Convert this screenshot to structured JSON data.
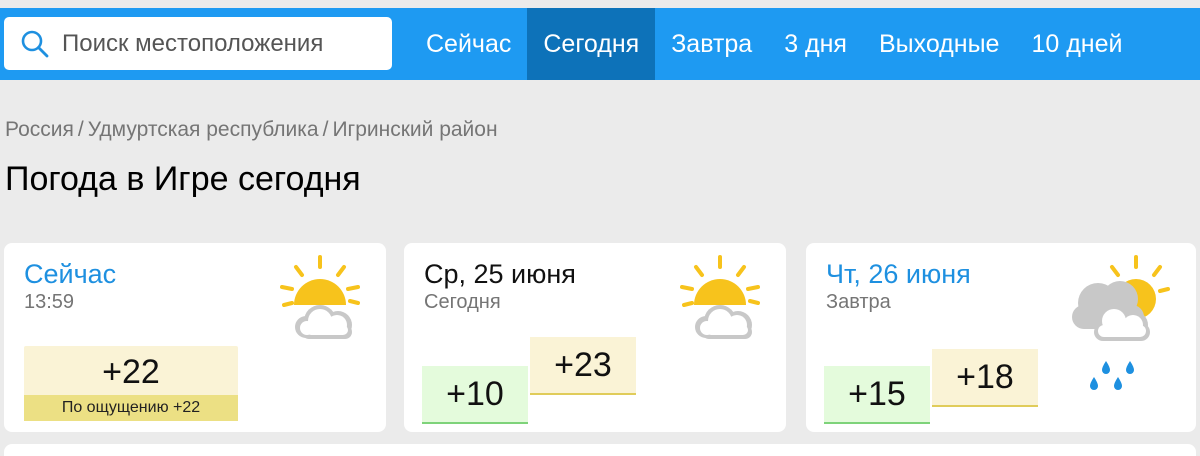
{
  "search": {
    "placeholder": "Поиск местоположения"
  },
  "nav": {
    "tabs": [
      {
        "label": "Сейчас",
        "active": false
      },
      {
        "label": "Сегодня",
        "active": true
      },
      {
        "label": "Завтра",
        "active": false
      },
      {
        "label": "3 дня",
        "active": false
      },
      {
        "label": "Выходные",
        "active": false
      },
      {
        "label": "10 дней",
        "active": false
      }
    ]
  },
  "breadcrumb": {
    "items": [
      "Россия",
      "Удмуртская республика",
      "Игринский район"
    ],
    "separator": "/"
  },
  "page_title": "Погода в Игре сегодня",
  "cards": {
    "now": {
      "label": "Сейчас",
      "time": "13:59",
      "temp": "+22",
      "feels_like": "По ощущению +22",
      "icon": "partly-cloudy-icon"
    },
    "today": {
      "label": "Ср, 25 июня",
      "sub": "Сегодня",
      "min": "+10",
      "max": "+23",
      "icon": "partly-cloudy-icon"
    },
    "tomorrow": {
      "label": "Чт, 26 июня",
      "sub": "Завтра",
      "min": "+15",
      "max": "+18",
      "icon": "cloudy-rain-icon"
    }
  },
  "colors": {
    "accent": "#1e9af2",
    "active_tab": "#0d72b9",
    "link_blue": "#1e90e0",
    "sun": "#f7c31c",
    "cloud": "#c8c8c8",
    "rain": "#1e90e0"
  }
}
